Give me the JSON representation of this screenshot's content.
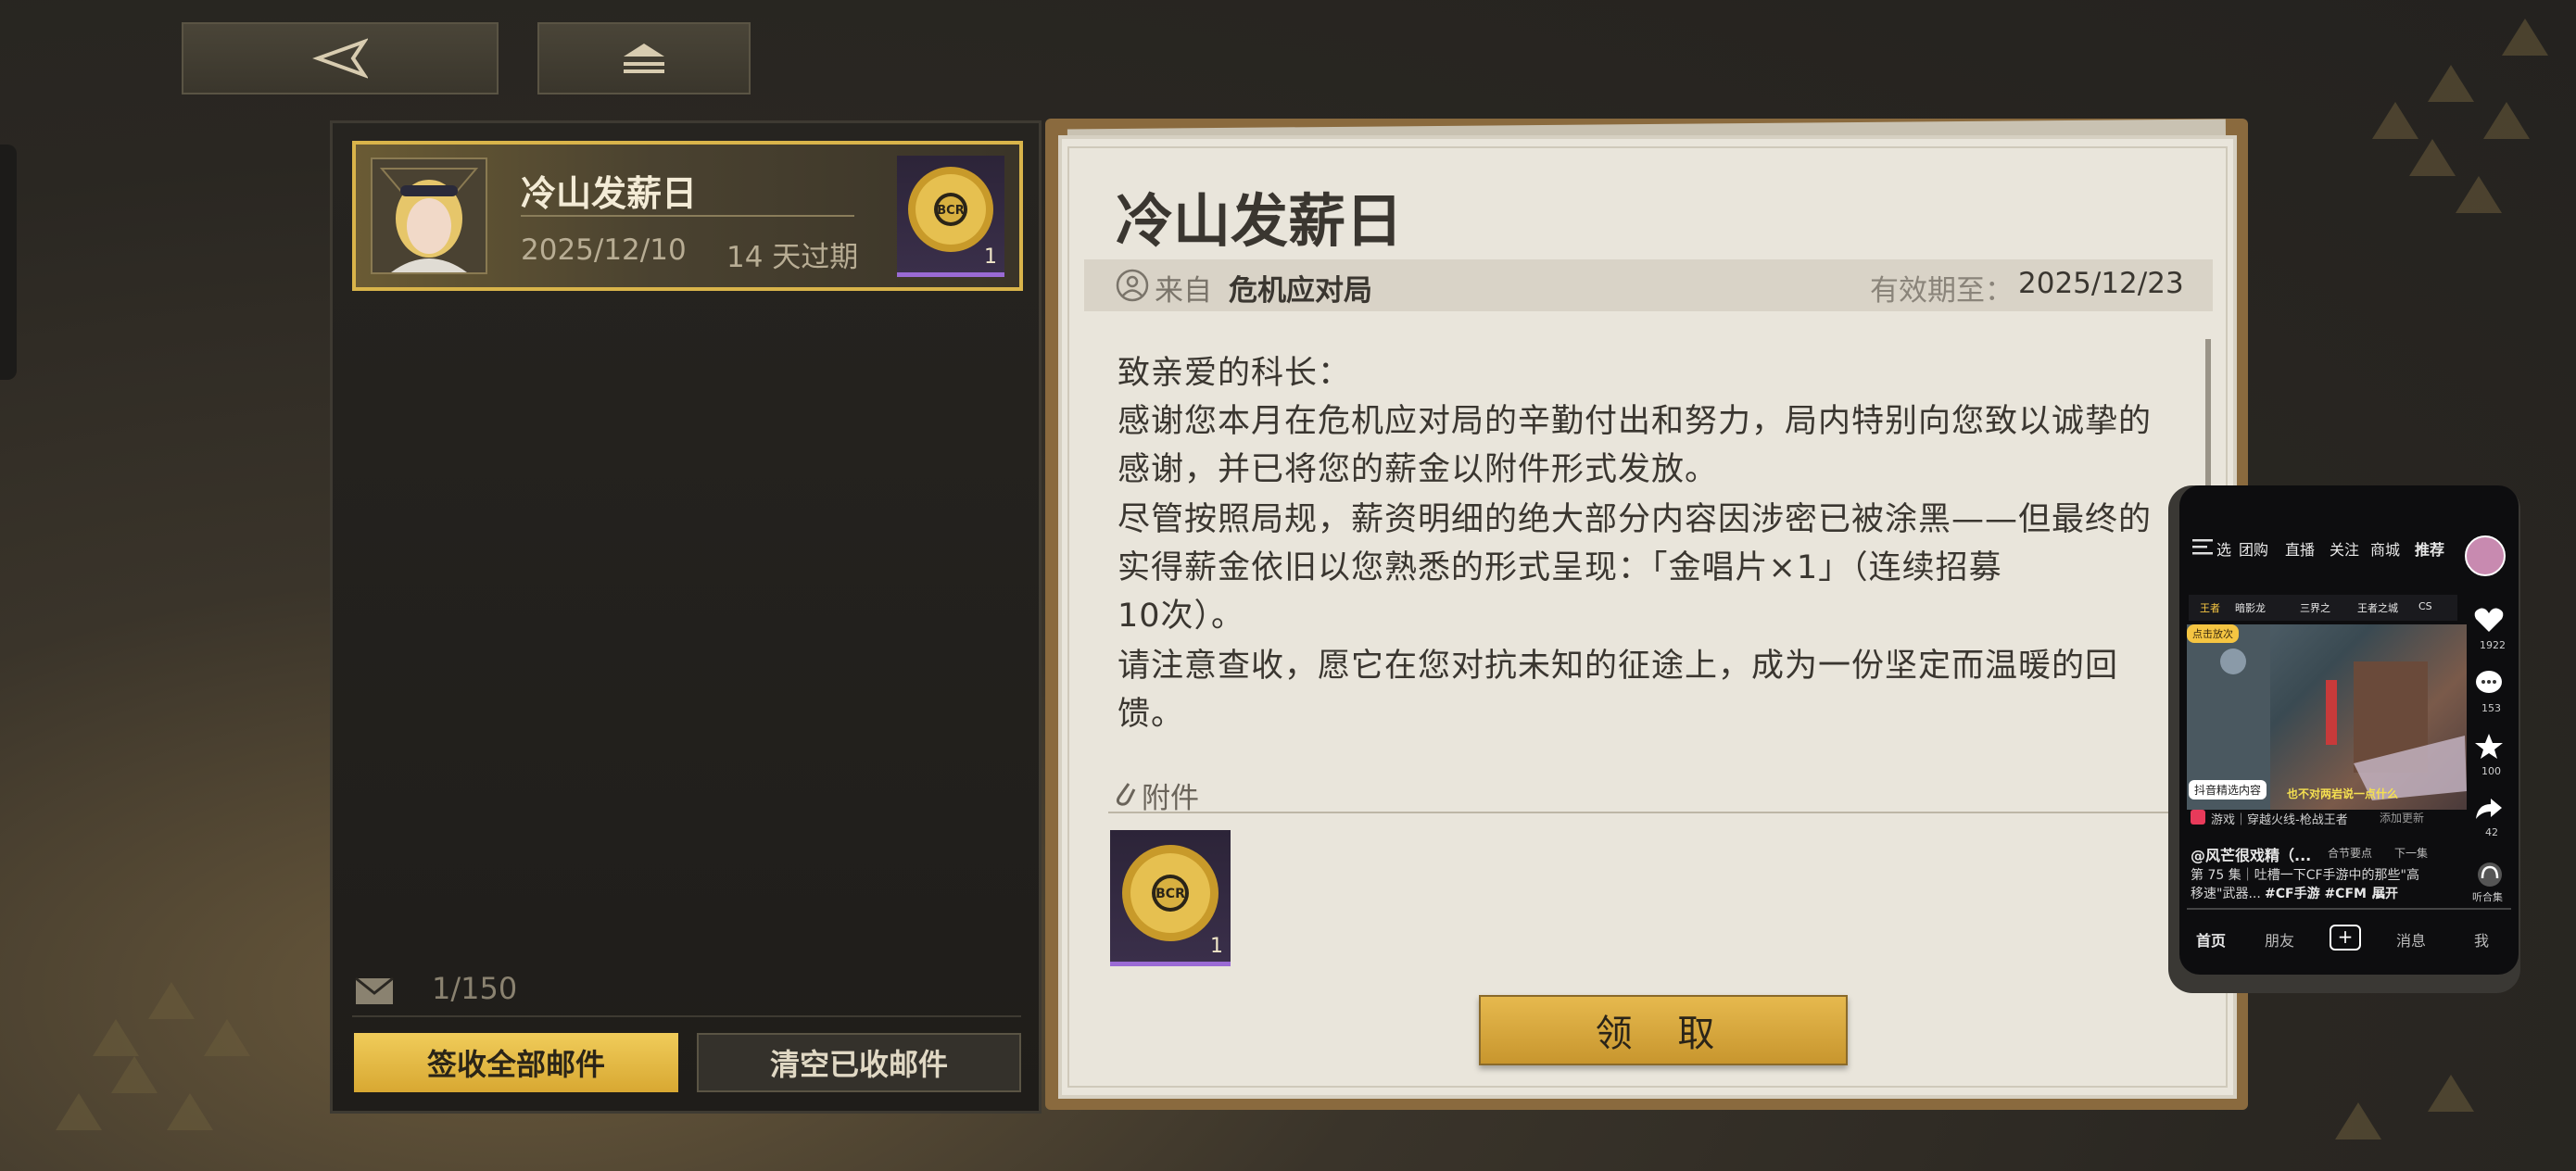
{
  "nav": {
    "back_icon": "back-triangle-icon",
    "home_icon": "home-icon"
  },
  "mail_list": {
    "items": [
      {
        "title": "冷山发薪日",
        "date": "2025/12/10",
        "expiry": "14 天过期",
        "attachment_count": "1"
      }
    ],
    "mail_count": "1/150",
    "claim_all_label": "签收全部邮件",
    "clear_label": "清空已收邮件"
  },
  "mail_detail": {
    "title": "冷山发薪日",
    "from_label": "来自",
    "sender": "危机应对局",
    "expiry_label": "有效期至：",
    "expiry_date": "2025/12/23",
    "body_lines": [
      "致亲爱的科长：",
      "感谢您本月在危机应对局的辛勤付出和努力，局内特别向您致以诚挚的",
      "感谢，并已将您的薪金以附件形式发放。",
      "尽管按照局规，薪资明细的绝大部分内容因涉密已被涂黑——但最终的",
      "实得薪金依旧以您熟悉的形式呈现：「金唱片×1」（连续招募",
      "10次）。",
      "请注意查收，愿它在您对抗未知的征途上，成为一份坚定而温暖的回",
      "馈。"
    ],
    "attachment_label": "附件",
    "attachment_count": "1",
    "claim_label": "领 取"
  },
  "phone_overlay": {
    "tabs": [
      "选",
      "团购",
      "直播",
      "关注",
      "商城",
      "推荐"
    ],
    "channels": [
      "王者",
      "暗影龙",
      "三界之",
      "王者之城",
      "CS"
    ],
    "live_badge": "点击放次",
    "selected_badge": "抖音精选内容",
    "video_caption": "也不对两岩说一点什么",
    "game_tag": "游戏｜穿越火线-枪战王者",
    "game_extra": "添加更新",
    "author": "@风芒很戏精（...",
    "chapter_tag": "合节要点",
    "next_label": "下一集",
    "desc_line1": "第 75 集｜吐槽一下CF手游中的那些\"高",
    "desc_line2": "移速\"武器...",
    "desc_tags": "#CF手游 #CFM ...",
    "expand": "展开",
    "side_counts": [
      "1922",
      "153",
      "100",
      "42"
    ],
    "listen_label": "听合集",
    "bottom_nav": [
      "首页",
      "朋友",
      "+",
      "消息",
      "我"
    ]
  },
  "colors": {
    "gold": "#d9b44a",
    "paper": "#e9e5db",
    "panel": "#24221f"
  }
}
